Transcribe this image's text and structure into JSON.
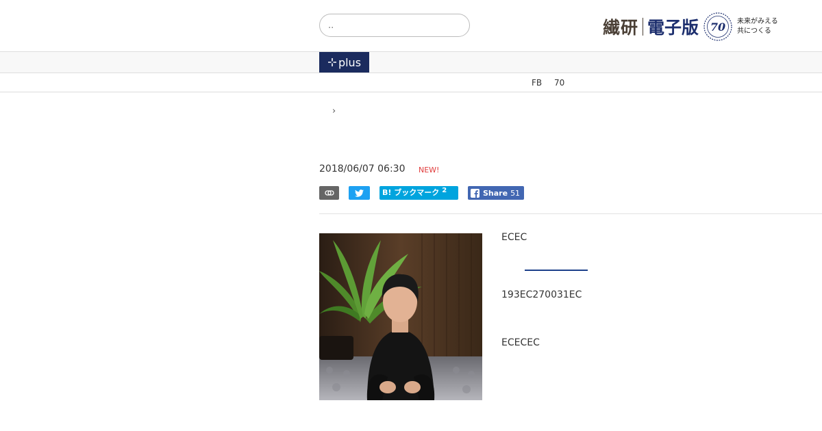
{
  "search": {
    "placeholder": "..",
    "value": ""
  },
  "logo": {
    "main": "繊研",
    "sub": "電子版",
    "anniversary_number": "70",
    "slogan_line1": "未来がみえる",
    "slogan_line2": "共につくる"
  },
  "nav": {
    "plus_label": "plus",
    "plus_icon": "sparkle-icon"
  },
  "subnav": {
    "item1": "FB",
    "item2": "70"
  },
  "breadcrumb": {
    "separator": "›"
  },
  "article": {
    "date": "2018/06/07 06:30",
    "badge": "NEW!",
    "share": {
      "link_icon": "link-icon",
      "twitter_icon": "twitter-icon",
      "hatena_label": "B! ブックマーク",
      "hatena_count": "2",
      "facebook_label": "Share",
      "facebook_count": "51",
      "facebook_icon": "facebook-icon"
    },
    "bio_line1": "ECEC",
    "bio_line2": "193EC270031EC",
    "bio_line3": "ECECEC"
  },
  "colors": {
    "nav_active": "#1b2b5e",
    "twitter": "#1da1f2",
    "hatena": "#00a4de",
    "facebook": "#4267b2",
    "new_badge": "#e03a3a"
  }
}
